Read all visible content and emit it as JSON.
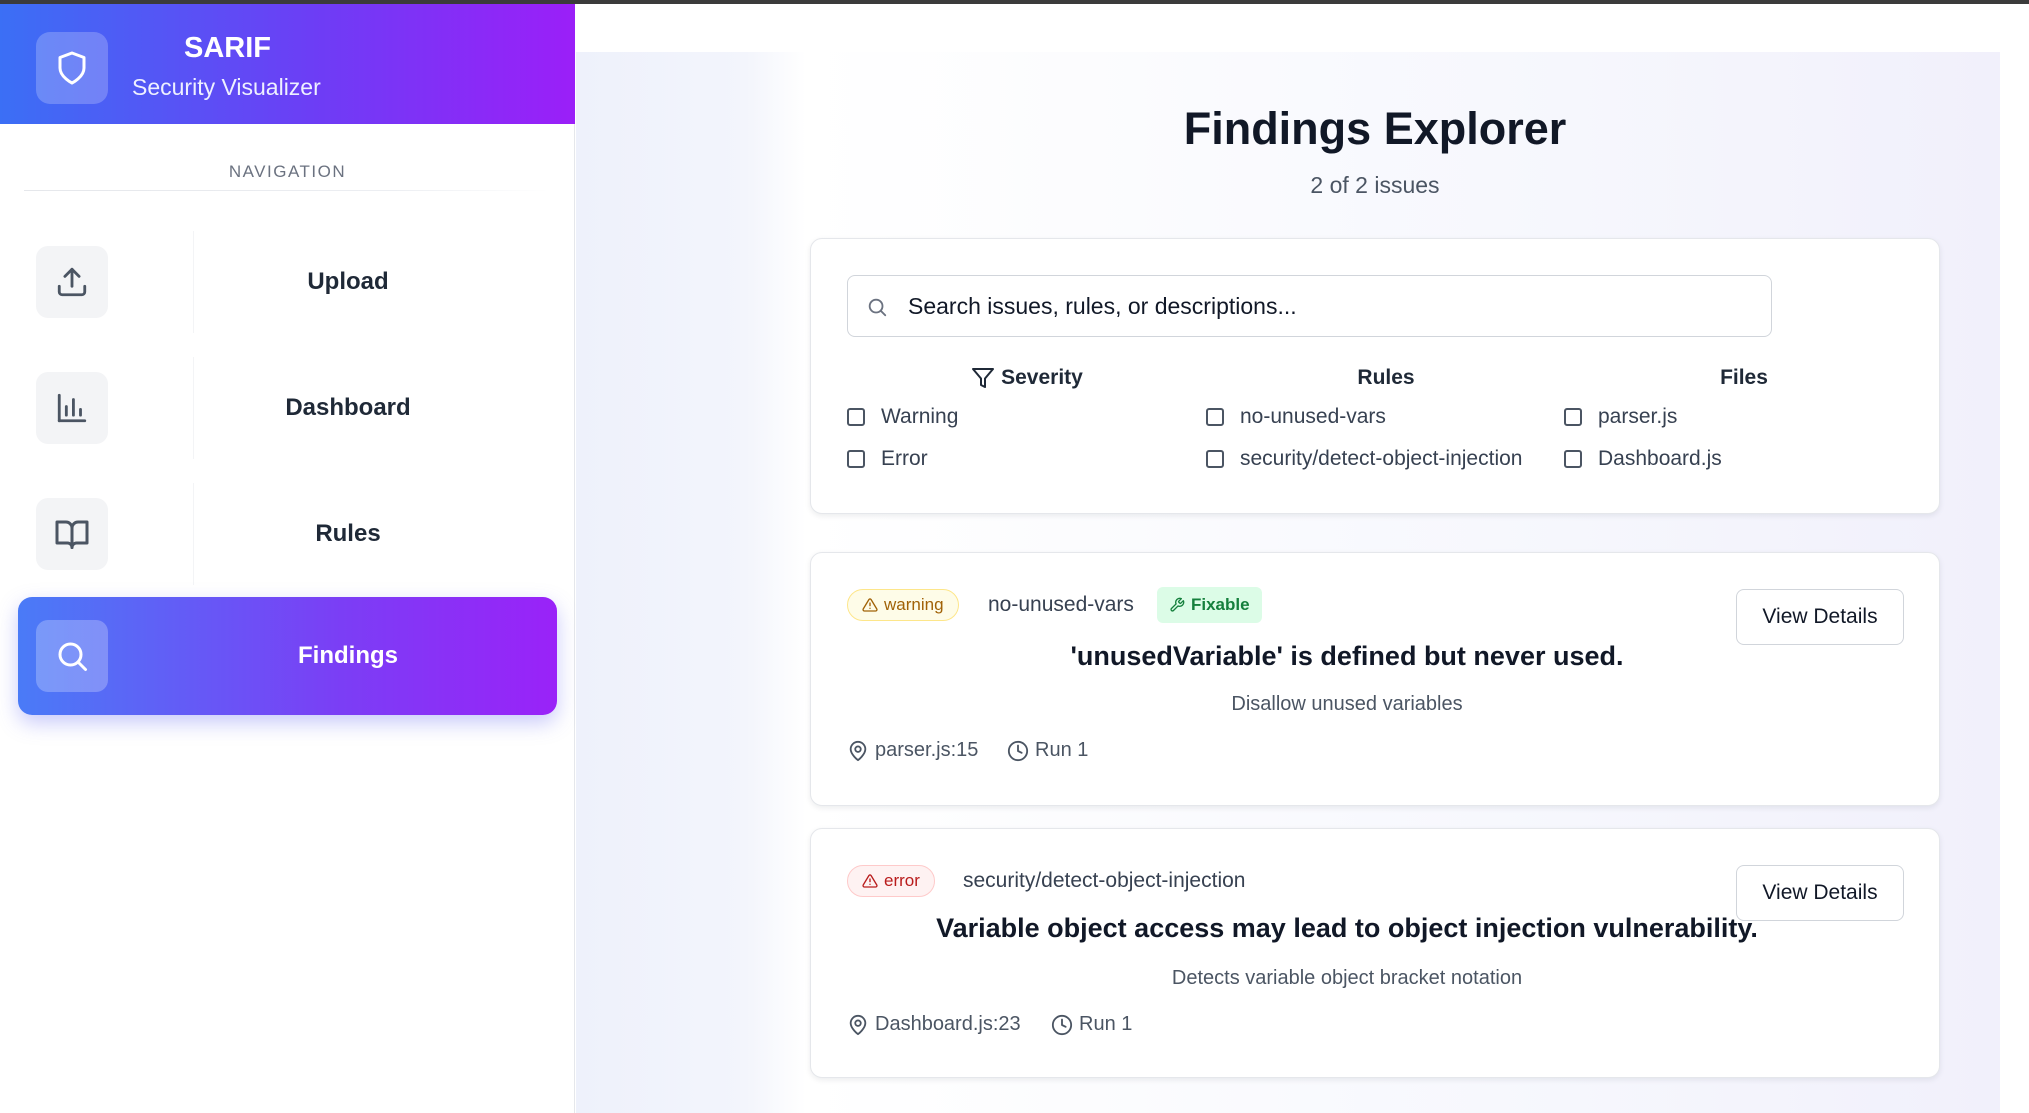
{
  "brand": {
    "title": "SARIF",
    "subtitle": "Security Visualizer"
  },
  "navigation": {
    "heading": "NAVIGATION",
    "items": [
      {
        "label": "Upload",
        "icon": "upload-icon",
        "active": false
      },
      {
        "label": "Dashboard",
        "icon": "bar-chart-icon",
        "active": false
      },
      {
        "label": "Rules",
        "icon": "book-icon",
        "active": false
      },
      {
        "label": "Findings",
        "icon": "search-icon",
        "active": true
      }
    ]
  },
  "page": {
    "title": "Findings Explorer",
    "count": "2 of 2 issues"
  },
  "search": {
    "placeholder": "Search issues, rules, or descriptions..."
  },
  "filters": {
    "severity": {
      "label": "Severity",
      "options": [
        "Warning",
        "Error"
      ]
    },
    "rules": {
      "label": "Rules",
      "options": [
        "no-unused-vars",
        "security/detect-object-injection"
      ]
    },
    "files": {
      "label": "Files",
      "options": [
        "parser.js",
        "Dashboard.js"
      ]
    }
  },
  "issues": [
    {
      "severity": "warning",
      "rule": "no-unused-vars",
      "fixable": "Fixable",
      "message": "'unusedVariable' is defined but never used.",
      "description": "Disallow unused variables",
      "location": "parser.js:15",
      "run": "Run 1",
      "action": "View Details"
    },
    {
      "severity": "error",
      "rule": "security/detect-object-injection",
      "message": "Variable object access may lead to object injection vulnerability.",
      "description": "Detects variable object bracket notation",
      "location": "Dashboard.js:23",
      "run": "Run 1",
      "action": "View Details"
    }
  ],
  "colors": {
    "brand_gradient_start": "#3b6ff5",
    "brand_gradient_end": "#9b1ff8",
    "warning": "#a16207",
    "error": "#b91c1c",
    "fixable": "#15803d"
  }
}
